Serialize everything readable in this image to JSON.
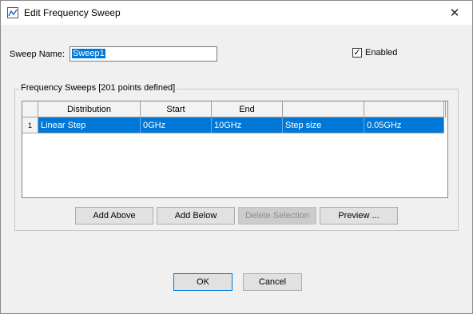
{
  "window": {
    "title": "Edit Frequency Sweep",
    "close_glyph": "✕"
  },
  "sweep_name": {
    "label": "Sweep Name:",
    "value": "Sweep1"
  },
  "enabled": {
    "label": "Enabled",
    "checked": true,
    "check_glyph": "✓"
  },
  "group": {
    "title": "Frequency Sweeps [201 points defined]"
  },
  "table": {
    "columns": [
      "Distribution",
      "Start",
      "End",
      "",
      ""
    ],
    "rows": [
      {
        "index": "1",
        "cells": [
          "Linear Step",
          "0GHz",
          "10GHz",
          "Step size",
          "0.05GHz"
        ]
      }
    ]
  },
  "table_buttons": {
    "add_above": "Add Above",
    "add_below": "Add Below",
    "delete_selection": "Delete Selection",
    "preview": "Preview ..."
  },
  "dialog_buttons": {
    "ok": "OK",
    "cancel": "Cancel"
  },
  "colors": {
    "selection": "#0078d7",
    "dialog_bg": "#f0f0f0"
  }
}
